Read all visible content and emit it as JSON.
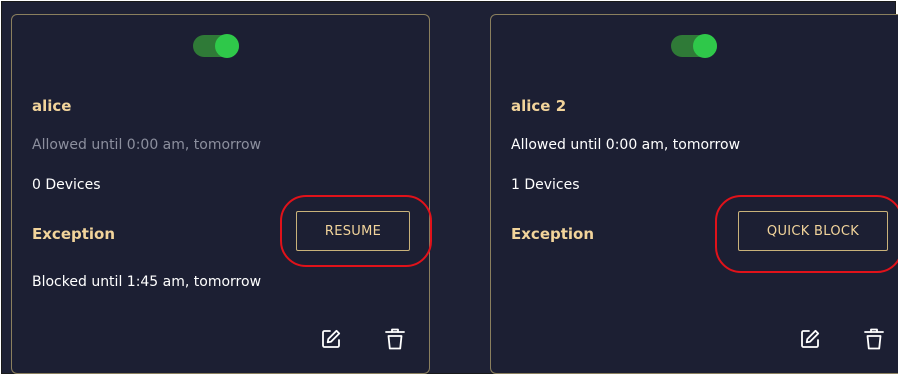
{
  "cards": [
    {
      "enabled": true,
      "name": "alice",
      "allowed_text": "Allowed until 0:00 am, tomorrow",
      "devices_text": "0 Devices",
      "exception_label": "Exception",
      "action_label": "RESUME",
      "blocked_text": "Blocked until 1:45 am, tomorrow"
    },
    {
      "enabled": true,
      "name": "alice 2",
      "allowed_text": "Allowed until 0:00 am, tomorrow",
      "devices_text": "1 Devices",
      "exception_label": "Exception",
      "action_label": "QUICK BLOCK",
      "blocked_text": ""
    }
  ],
  "icons": {
    "edit": "edit-icon",
    "delete": "trash-icon"
  },
  "colors": {
    "background": "#1e2135",
    "accent": "#f2d49b",
    "toggle_on": "#2fc84a",
    "highlight": "#e0121a"
  }
}
